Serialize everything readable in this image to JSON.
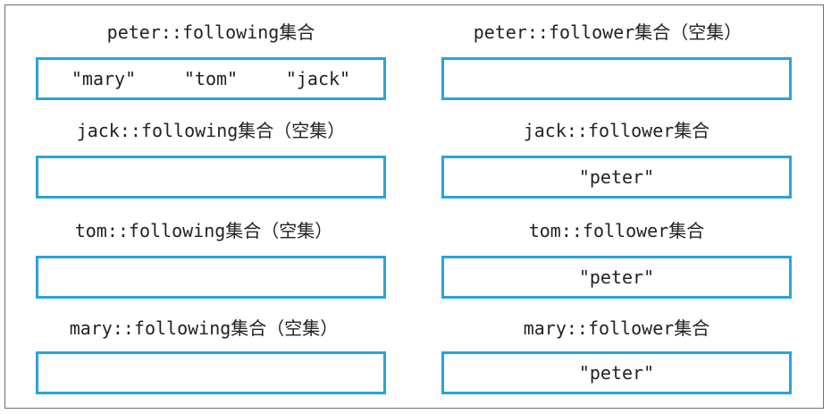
{
  "colors": {
    "box_border": "#29a3dc",
    "frame_border": "#6f6f6f",
    "text": "#222222"
  },
  "rows": [
    {
      "following": {
        "title": "peter::following集合",
        "members": [
          "\"mary\"",
          "\"tom\"",
          "\"jack\""
        ]
      },
      "follower": {
        "title": "peter::follower集合（空集）",
        "members": []
      }
    },
    {
      "following": {
        "title": "jack::following集合（空集）",
        "members": []
      },
      "follower": {
        "title": "jack::follower集合",
        "members": [
          "\"peter\""
        ]
      }
    },
    {
      "following": {
        "title": "tom::following集合（空集）",
        "members": []
      },
      "follower": {
        "title": "tom::follower集合",
        "members": [
          "\"peter\""
        ]
      }
    },
    {
      "following": {
        "title": "mary::following集合（空集）",
        "members": []
      },
      "follower": {
        "title": "mary::follower集合",
        "members": [
          "\"peter\""
        ]
      }
    }
  ]
}
